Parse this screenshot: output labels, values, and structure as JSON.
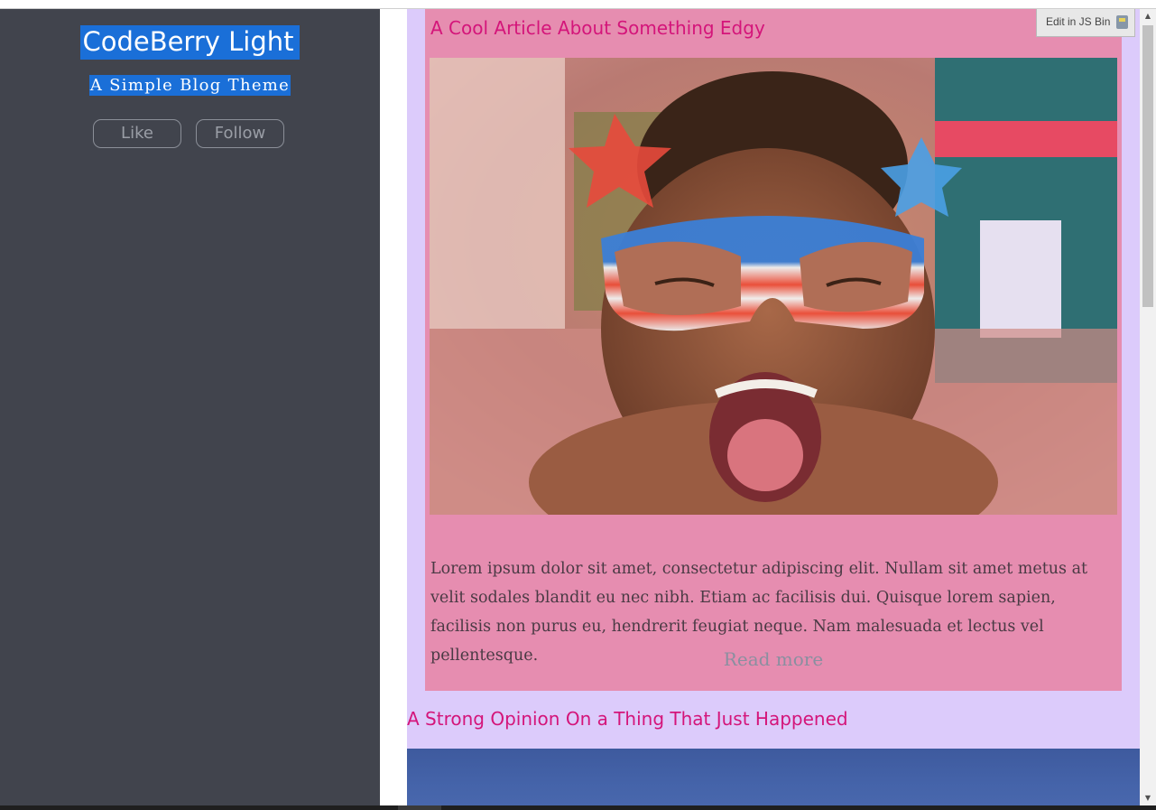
{
  "sidebar": {
    "title": "CodeBerry Light",
    "subtitle": "A Simple Blog Theme",
    "like_label": "Like",
    "follow_label": "Follow"
  },
  "posts": [
    {
      "title": "A Cool Article About Something Edgy",
      "image_alt": "child-with-star-glasses-photo",
      "excerpt": "Lorem ipsum dolor sit amet, consectetur adipiscing elit. Nullam sit amet metus at velit sodales blandit eu nec nibh. Etiam ac facilisis dui. Quisque lorem sapien, facilisis non purus eu, hendrerit feugiat neque. Nam malesuada et lectus vel pellentesque.",
      "read_more": "Read more"
    },
    {
      "title": "A Strong Opinion On a Thing That Just Happened"
    }
  ],
  "jsbin_label": "Edit in JS Bin",
  "colors": {
    "sidebar_bg": "#41444d",
    "highlight": "#1a6fd8",
    "main_bg": "#dccbfb",
    "card_bg": "#e68db0",
    "title_color": "#d4157a"
  }
}
